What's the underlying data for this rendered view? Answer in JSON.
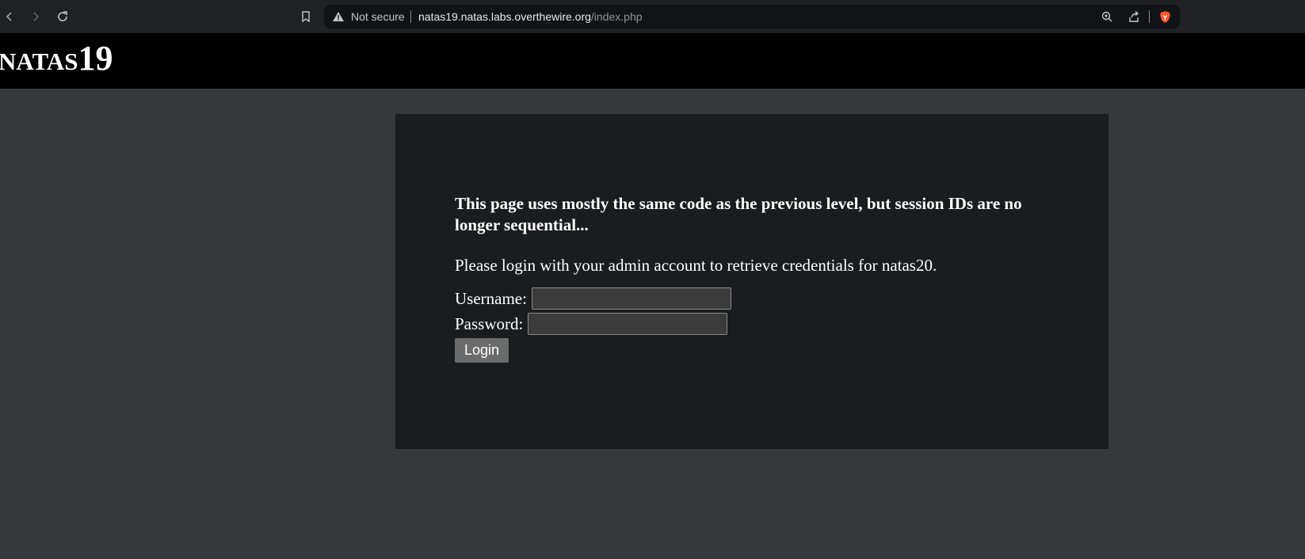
{
  "browser": {
    "security_label": "Not secure",
    "url_host": "natas19.natas.labs.overthewire.org",
    "url_path": "/index.php",
    "icons": [
      "back-icon",
      "forward-icon",
      "reload-icon",
      "bookmark-icon",
      "warning-icon",
      "zoom-icon",
      "share-icon",
      "brave-icon"
    ]
  },
  "header": {
    "title": "natas19"
  },
  "main": {
    "intro": "This page uses mostly the same code as the previous level, but session IDs are no longer sequential...",
    "instruction": "Please login with your admin account to retrieve credentials for natas20.",
    "username_label": "Username:",
    "password_label": "Password:",
    "username_value": "",
    "password_value": "",
    "login_label": "Login"
  },
  "colors": {
    "page_bg": "#35393c",
    "header_bg": "#000000",
    "content_bg": "#1b1c1e",
    "brave_orange": "#fb542b"
  }
}
